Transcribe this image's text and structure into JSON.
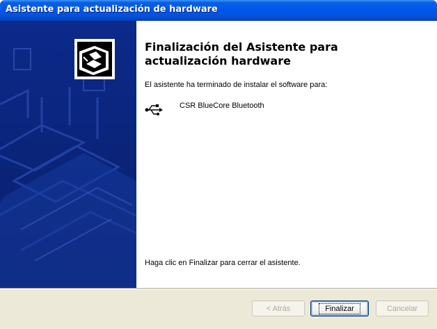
{
  "window": {
    "title": "Asistente para actualización de hardware"
  },
  "content": {
    "heading_line1": "Finalización del Asistente para",
    "heading_line2": "actualización hardware",
    "subtext": "El asistente ha terminado de instalar el software para:",
    "device_icon": "usb-icon",
    "device_name": "CSR BlueCore Bluetooth",
    "finish_text": "Haga clic en Finalizar para cerrar el asistente."
  },
  "buttons": {
    "back_label": "< Atrás",
    "finish_label": "Finalizar",
    "cancel_label": "Cancelar",
    "back_enabled": false,
    "finish_enabled": true,
    "cancel_enabled": false
  },
  "colors": {
    "titlebar": "#0058ee",
    "sidebar": "#0a247a",
    "button_bar": "#ece9d8"
  }
}
